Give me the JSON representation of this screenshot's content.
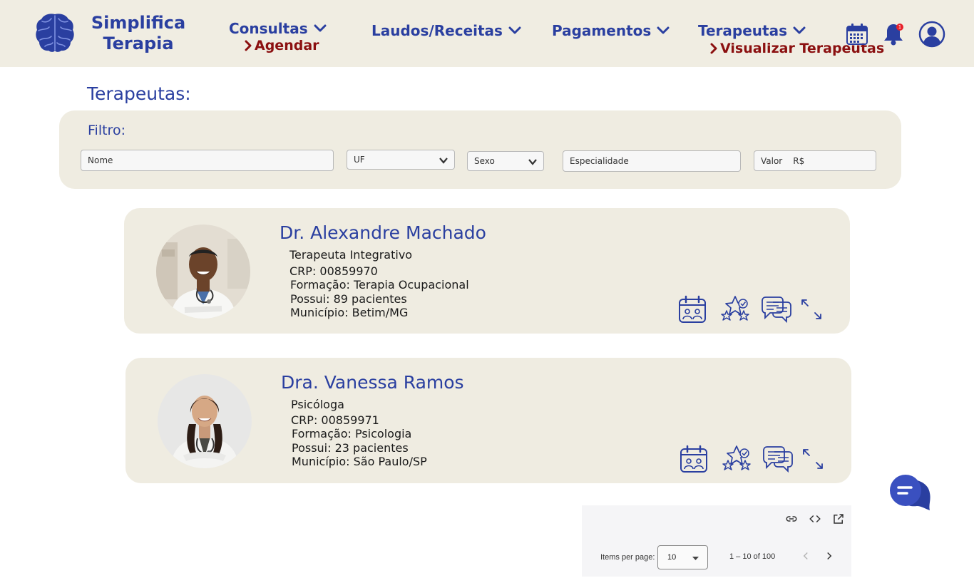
{
  "header": {
    "brand_line1": "Simplifica",
    "brand_line2": "Terapia",
    "nav": [
      {
        "label": "Consultas",
        "sub": "Agendar"
      },
      {
        "label": "Laudos/Receitas"
      },
      {
        "label": "Pagamentos"
      },
      {
        "label": "Terapeutas",
        "sub": "Visualizar Terapeutas"
      }
    ],
    "notification_count": "1"
  },
  "page_title": "Terapeutas:",
  "filter": {
    "label": "Filtro:",
    "nome_placeholder": "Nome",
    "uf_placeholder": "UF",
    "sexo_placeholder": "Sexo",
    "especialidade_placeholder": "Especialidade",
    "valor_placeholder": "Valor",
    "currency": "R$"
  },
  "therapists": [
    {
      "name": "Dr. Alexandre Machado",
      "title": "Terapeuta Integrativo",
      "crp": "CRP: 00859970",
      "formacao": "Formação: Terapia Ocupacional",
      "pacientes": "Possui: 89 pacientes",
      "municipio": "Município: Betim/MG"
    },
    {
      "name": "Dra. Vanessa Ramos",
      "title": "Psicóloga",
      "crp": "CRP: 00859971",
      "formacao": "Formação: Psicologia",
      "pacientes": "Possui: 23 pacientes",
      "municipio": "Município: São Paulo/SP"
    }
  ],
  "pagination": {
    "items_per_page_label": "Items per page:",
    "items_per_page": "10",
    "range": "1 – 10 of 100"
  },
  "colors": {
    "primary": "#2a3fa0",
    "accent": "#8b1010",
    "header_bg": "#f0ede2",
    "card_bg": "#efece1"
  },
  "icons": {
    "brain": "brain-icon",
    "calendar": "calendar-icon",
    "bell": "bell-icon",
    "user": "user-icon",
    "schedule": "schedule-icon",
    "rating": "rating-stars-icon",
    "chat": "chat-icon",
    "expand": "expand-icon"
  }
}
